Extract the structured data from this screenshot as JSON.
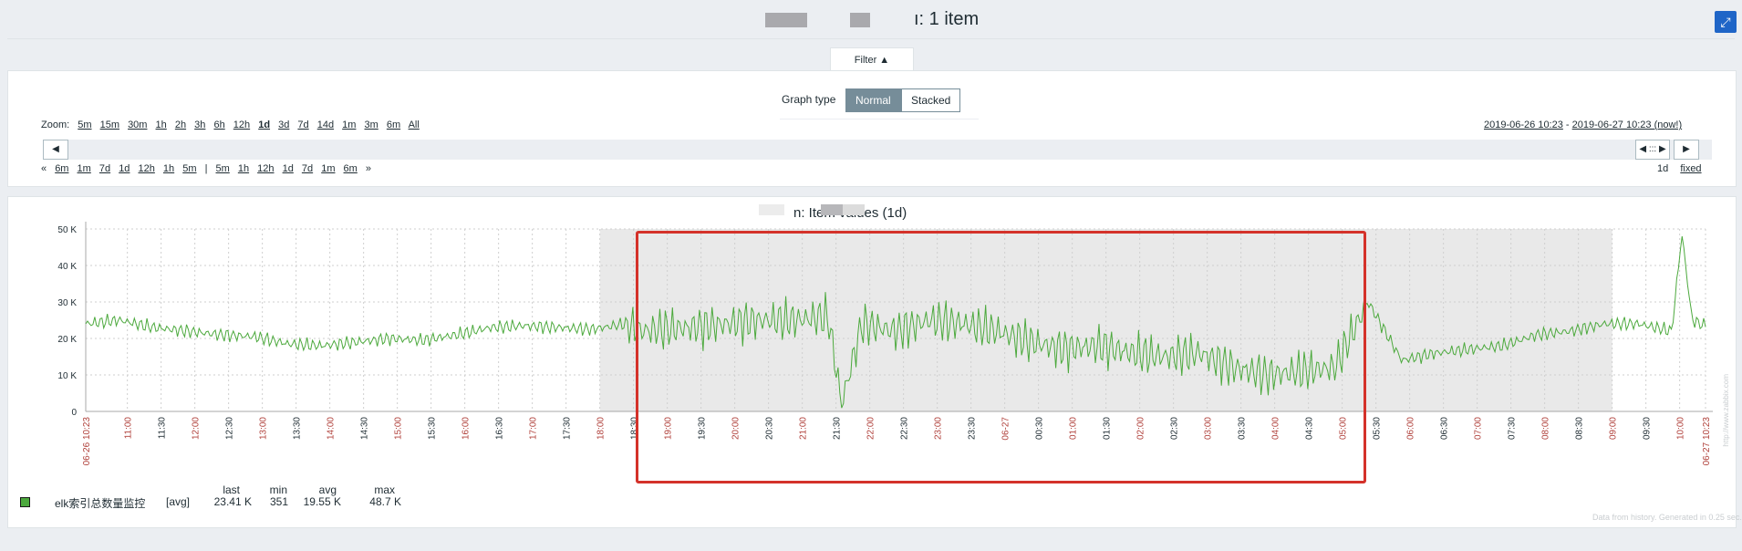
{
  "header": {
    "title_suffix": "ı: 1 item"
  },
  "filter": {
    "tab_label": "Filter ▲",
    "graph_type_label": "Graph type",
    "graph_types": [
      "Normal",
      "Stacked"
    ],
    "selected_graph_type": "Normal"
  },
  "zoom": {
    "label": "Zoom:",
    "options": [
      "5m",
      "15m",
      "30m",
      "1h",
      "2h",
      "3h",
      "6h",
      "12h",
      "1d",
      "3d",
      "7d",
      "14d",
      "1m",
      "3m",
      "6m",
      "All"
    ],
    "active": "1d"
  },
  "time_range": {
    "from": "2019-06-26 10:23",
    "sep": "-",
    "to": "2019-06-27 10:23 (now!)"
  },
  "navigation": {
    "back_label": "◀",
    "forward_label": "▶",
    "handle_label": "◀ ::: ▶"
  },
  "shift": {
    "left_marker": "«",
    "back_options": [
      "6m",
      "1m",
      "7d",
      "1d",
      "12h",
      "1h",
      "5m"
    ],
    "divider": "|",
    "forward_options": [
      "5m",
      "1h",
      "12h",
      "1d",
      "7d",
      "1m",
      "6m"
    ],
    "right_marker": "»",
    "period_label": "1d",
    "fixed_label": "fixed"
  },
  "graph": {
    "title_suffix": "n: Item values (1d)",
    "footer_note": "Data from history. Generated in 0.25 sec.",
    "watermark": "http://www.zabbix.com",
    "colors": {
      "series": "#4ca93d",
      "highlight": "#d4322a",
      "night_band": "#e9e9e9",
      "hour_label_red": "#b0413b"
    },
    "night_shading": {
      "from": "18:00",
      "to": "09:00"
    }
  },
  "chart_data": {
    "type": "line",
    "xlabel": "",
    "ylabel": "",
    "ylim": [
      0,
      50000
    ],
    "y_ticks": [
      "0",
      "10 K",
      "20 K",
      "30 K",
      "40 K",
      "50 K"
    ],
    "x_ticks": [
      "06-26 10:23",
      "11:00",
      "11:30",
      "12:00",
      "12:30",
      "13:00",
      "13:30",
      "14:00",
      "14:30",
      "15:00",
      "15:30",
      "16:00",
      "16:30",
      "17:00",
      "17:30",
      "18:00",
      "18:30",
      "19:00",
      "19:30",
      "20:00",
      "20:30",
      "21:00",
      "21:30",
      "22:00",
      "22:30",
      "23:00",
      "23:30",
      "06-27",
      "00:30",
      "01:00",
      "01:30",
      "02:00",
      "02:30",
      "03:00",
      "03:30",
      "04:00",
      "04:30",
      "05:00",
      "05:30",
      "06:00",
      "06:30",
      "07:00",
      "07:30",
      "08:00",
      "08:30",
      "09:00",
      "09:30",
      "10:00",
      "06-27 10:23"
    ],
    "x_tick_hours": [
      0,
      0.617,
      1.117,
      1.617,
      2.117,
      2.617,
      3.117,
      3.617,
      4.117,
      4.617,
      5.117,
      5.617,
      6.117,
      6.617,
      7.117,
      7.617,
      8.117,
      8.617,
      9.117,
      9.617,
      10.117,
      10.617,
      11.117,
      11.617,
      12.117,
      12.617,
      13.117,
      13.617,
      14.117,
      14.617,
      15.117,
      15.617,
      16.117,
      16.617,
      17.117,
      17.617,
      18.117,
      18.617,
      19.117,
      19.617,
      20.117,
      20.617,
      21.117,
      21.617,
      22.117,
      22.617,
      23.117,
      23.617,
      24
    ],
    "series": [
      {
        "name": "elk索引总数量监控",
        "color": "#4ca93d",
        "x_hours": [
          0,
          0.5,
          1,
          1.5,
          2,
          2.5,
          3,
          3.5,
          4,
          4.5,
          5,
          5.5,
          6,
          6.5,
          7,
          7.5,
          8,
          8.25,
          8.5,
          9,
          9.5,
          10,
          10.5,
          11,
          11.2,
          11.5,
          12,
          12.5,
          13,
          13.5,
          14,
          14.5,
          15,
          15.5,
          16,
          16.5,
          17,
          17.5,
          18,
          18.5,
          19,
          19.5,
          20,
          20.5,
          21,
          21.5,
          22,
          22.5,
          23,
          23.5,
          23.65,
          23.8,
          24
        ],
        "values": [
          24000,
          25000,
          23000,
          22000,
          21000,
          20500,
          18500,
          18000,
          19000,
          20000,
          19500,
          21000,
          23000,
          23500,
          23000,
          22500,
          24000,
          22000,
          22500,
          23000,
          24000,
          25000,
          25000,
          26000,
          2000,
          24000,
          22000,
          25000,
          24000,
          22000,
          19000,
          17000,
          18000,
          16000,
          15000,
          16000,
          12000,
          10000,
          11000,
          12000,
          30000,
          14000,
          16000,
          17000,
          18000,
          21000,
          22000,
          24000,
          24000,
          22000,
          48700,
          25000,
          23410
        ]
      }
    ],
    "legend": {
      "item": "elk索引总数量监控",
      "function": "[avg]",
      "headers": [
        "last",
        "min",
        "avg",
        "max"
      ],
      "values": [
        "23.41 K",
        "351",
        "19.55 K",
        "48.7 K"
      ]
    }
  }
}
